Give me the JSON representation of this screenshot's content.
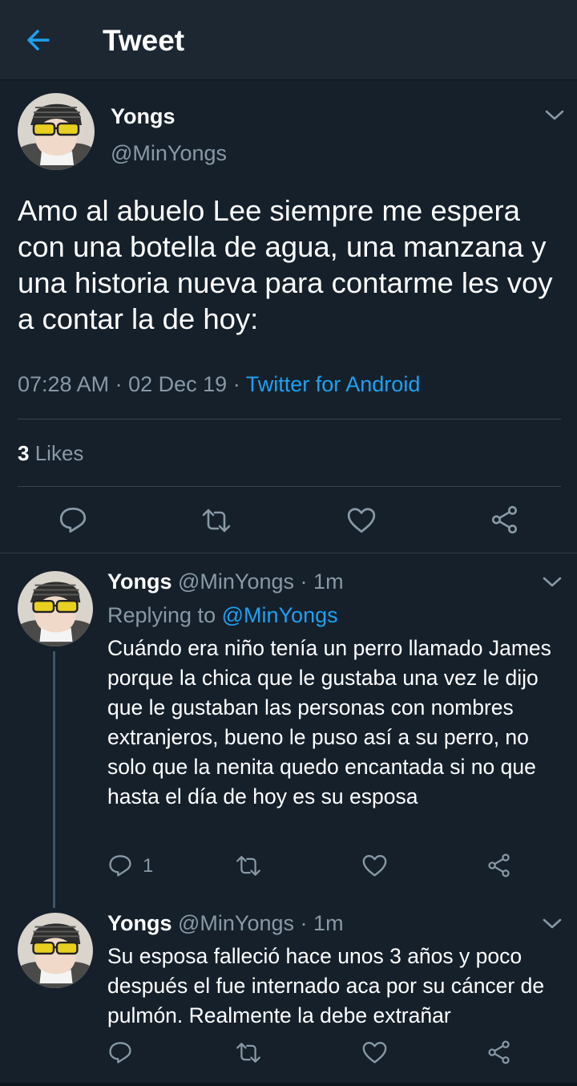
{
  "header": {
    "title": "Tweet"
  },
  "main_tweet": {
    "name": "Yongs",
    "handle": "@MinYongs",
    "text": "Amo al abuelo Lee siempre me espera con una botella de agua, una manzana y una historia nueva para contarme les voy a contar la de hoy:",
    "time": "07:28 AM",
    "date": "02 Dec 19",
    "source": "Twitter for Android",
    "sep": "·",
    "likes_count": "3",
    "likes_label": "Likes"
  },
  "replies": [
    {
      "name": "Yongs",
      "handle": "@MinYongs",
      "time": "1m",
      "replying_label": "Replying to",
      "replying_handle": "@MinYongs",
      "text": "Cuándo era niño tenía un perro llamado James porque la chica que le gustaba una vez le dijo que le gustaban las personas con nombres extranjeros, bueno le puso así a su perro, no solo que la nenita quedo encantada si no que hasta el día de hoy es su esposa",
      "reply_count": "1"
    },
    {
      "name": "Yongs",
      "handle": "@MinYongs",
      "time": "1m",
      "text": "Su esposa falleció hace unos 3 años y poco después el fue internado aca por su cáncer de pulmón. Realmente la debe extrañar"
    }
  ],
  "colors": {
    "background": "#15202b",
    "header": "#1c2732",
    "accent": "#1da1f2",
    "muted": "#8899a6",
    "divider": "#38444d"
  },
  "icons": [
    "back-arrow-icon",
    "chevron-down-icon",
    "reply-icon",
    "retweet-icon",
    "like-heart-icon",
    "share-icon"
  ]
}
